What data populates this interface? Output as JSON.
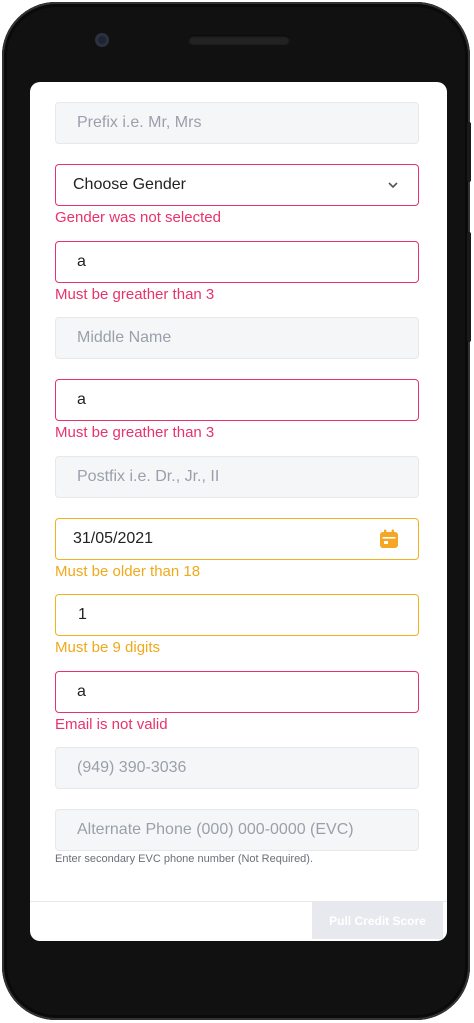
{
  "form": {
    "prefix_placeholder": "Prefix i.e. Mr, Mrs",
    "gender_value": "Choose Gender",
    "gender_error": "Gender was not selected",
    "first_name_value": "a",
    "first_name_error": "Must be greather than 3",
    "middle_name_placeholder": "Middle Name",
    "last_name_value": "a",
    "last_name_error": "Must be greather than 3",
    "postfix_placeholder": "Postfix i.e. Dr., Jr., II",
    "dob_value": "31/05/2021",
    "dob_error": "Must be older than 18",
    "ssn_value": "1",
    "ssn_error": "Must be 9 digits",
    "email_value": "a",
    "email_error": "Email is not valid",
    "phone_placeholder": "(949) 390-3036",
    "alt_phone_placeholder": "Alternate Phone (000) 000-0000 (EVC)",
    "alt_phone_hint": "Enter secondary EVC phone number (Not Required)."
  },
  "footer": {
    "pull_button_label": "Pull Credit Score"
  },
  "icons": {
    "gender_dropdown": "chevron-down-icon",
    "dob_picker": "calendar-icon"
  },
  "colors": {
    "error_red": "#e7336b",
    "warning_yellow": "#f3b21c",
    "field_background": "#f5f6f8"
  }
}
